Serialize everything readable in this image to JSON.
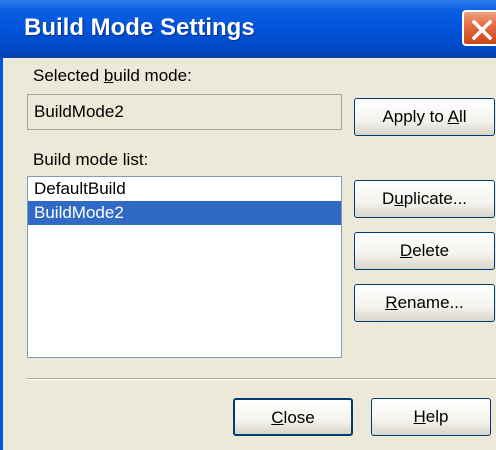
{
  "window": {
    "title": "Build Mode Settings"
  },
  "selected_mode": {
    "label_pre": "Selected ",
    "label_hot": "b",
    "label_post": "uild mode:",
    "value": "BuildMode2"
  },
  "list_section": {
    "label": "Build mode list:",
    "items": [
      "DefaultBuild",
      "BuildMode2"
    ],
    "selected_index": 1
  },
  "buttons": {
    "apply_pre": "Apply to ",
    "apply_hot": "A",
    "apply_post": "ll",
    "duplicate_pre": "D",
    "duplicate_hot": "u",
    "duplicate_post": "plicate...",
    "delete_hot": "D",
    "delete_post": "elete",
    "rename_hot": "R",
    "rename_post": "ename...",
    "close_hot": "C",
    "close_post": "lose",
    "help_hot": "H",
    "help_post": "elp"
  },
  "colors": {
    "titlebar": "#0053db",
    "selection": "#316ac5",
    "close_button": "#e26a3e",
    "dialog_background": "#ece9d8"
  }
}
